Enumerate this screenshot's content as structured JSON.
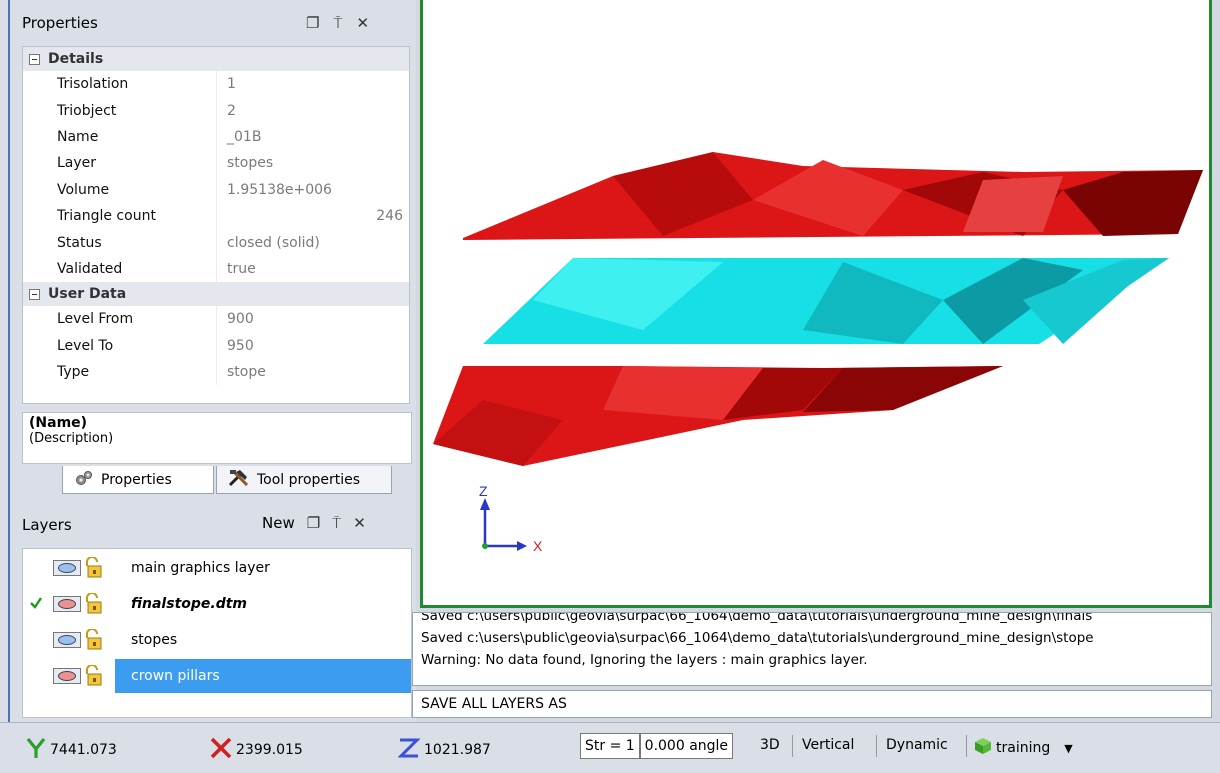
{
  "properties_panel": {
    "title": "Properties",
    "icons": [
      "restore-icon",
      "pin-icon",
      "close-icon"
    ],
    "categories": [
      {
        "label": "Details",
        "rows": [
          {
            "key": "Trisolation",
            "value": "1"
          },
          {
            "key": "Triobject",
            "value": "2"
          },
          {
            "key": "Name",
            "value": "_01B"
          },
          {
            "key": "Layer",
            "value": "stopes"
          },
          {
            "key": "Volume",
            "value": "1.95138e+006"
          },
          {
            "key": "Triangle count",
            "value": "246"
          },
          {
            "key": "Status",
            "value": "closed (solid)"
          },
          {
            "key": "Validated",
            "value": "true"
          }
        ]
      },
      {
        "label": "User Data",
        "rows": [
          {
            "key": "Level From",
            "value": "900"
          },
          {
            "key": "Level To",
            "value": "950"
          },
          {
            "key": "Type",
            "value": "stope"
          }
        ]
      }
    ],
    "description": {
      "name": "(Name)",
      "text": "(Description)"
    },
    "tabs": [
      {
        "label": "Properties",
        "icon": "gears-icon"
      },
      {
        "label": "Tool properties",
        "icon": "tools-icon"
      }
    ]
  },
  "layers_panel": {
    "title": "Layers",
    "new_label": "New",
    "items": [
      {
        "label": "main graphics layer",
        "checked": false,
        "eye": "blue",
        "bold": false,
        "selected": false
      },
      {
        "label": "finalstope.dtm",
        "checked": true,
        "eye": "red",
        "bold": true,
        "selected": false
      },
      {
        "label": "stopes",
        "checked": false,
        "eye": "blue",
        "bold": false,
        "selected": false
      },
      {
        "label": "crown pillars",
        "checked": false,
        "eye": "red",
        "bold": false,
        "selected": true
      }
    ]
  },
  "viewport": {
    "axis_labels": {
      "z": "Z",
      "x": "X"
    },
    "colors": {
      "stope_red": "#dc1616",
      "pillar_cyan": "#16e0e6",
      "border_green": "#1f8a2e",
      "axis_z": "#2a36c6",
      "axis_x": "#d02020"
    }
  },
  "messages": {
    "lines": [
      "Saved c:\\users\\public\\geovia\\surpac\\66_1064\\demo_data\\tutorials\\underground_mine_design\\finals",
      "Saved c:\\users\\public\\geovia\\surpac\\66_1064\\demo_data\\tutorials\\underground_mine_design\\stope",
      "Warning: No data found, Ignoring the layers : main graphics layer."
    ],
    "command": "SAVE ALL LAYERS AS"
  },
  "status_bar": {
    "y_value": "7441.073",
    "x_value": "2399.015",
    "z_value": "1021.987",
    "str_label": "Str = 1",
    "angle_label": "0.000 angle",
    "mode_3d": "3D",
    "vertical": "Vertical",
    "dynamic": "Dynamic",
    "profile": "training"
  }
}
